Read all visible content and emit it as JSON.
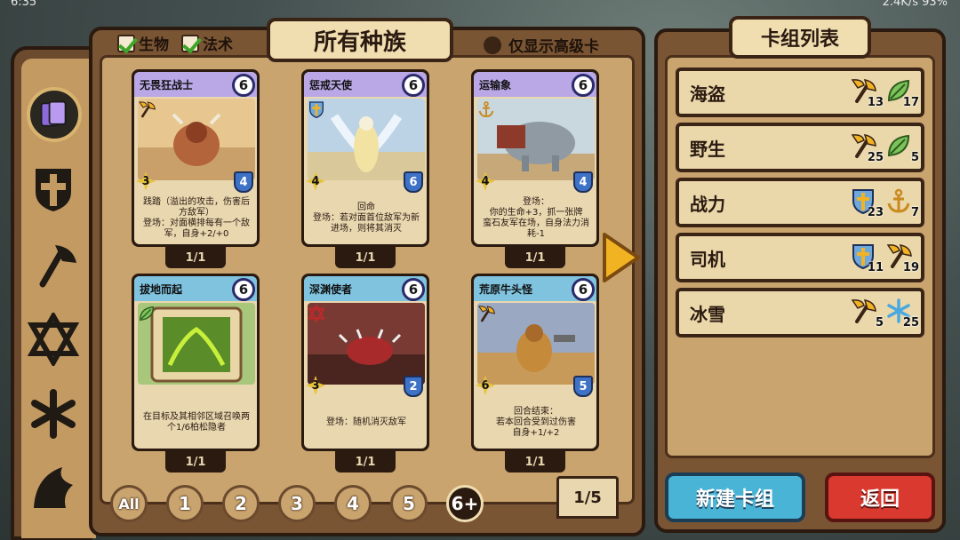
{
  "status_bar": {
    "time": "6:35",
    "right": "2.4K/s 93%"
  },
  "filters": {
    "creature_label": "生物",
    "spell_label": "法术",
    "advanced_label": "仅显示高级卡"
  },
  "tab_title": "所有种族",
  "cards": [
    {
      "name": "无畏狂战士",
      "cost": "6",
      "attack": "3",
      "health": "4",
      "text": "践踏（溢出的攻击，伤害后方敌军）\n登场：对面横排每有一个敌军，自身+2/+0",
      "count": "1/1",
      "head_color": "#b9a7e6",
      "type_icon": "axe-icon"
    },
    {
      "name": "惩戒天使",
      "cost": "6",
      "attack": "4",
      "health": "6",
      "text": "回命\n登场：若对面首位敌军为新进场，则将其消灭",
      "count": "1/1",
      "head_color": "#b9a7e6",
      "type_icon": "shield-icon"
    },
    {
      "name": "运输象",
      "cost": "6",
      "attack": "4",
      "health": "4",
      "text": "登场：\n你的生命+3，抓一张牌\n蛮石友军在场，自身法力消耗-1",
      "count": "1/1",
      "head_color": "#b9a7e6",
      "type_icon": "anchor-icon"
    },
    {
      "name": "拔地而起",
      "cost": "6",
      "attack": "",
      "health": "",
      "text": "在目标及其相邻区域召唤两个1/6柏松隐者",
      "count": "1/1",
      "head_color": "#7fc3df",
      "type_icon": "leaf-icon"
    },
    {
      "name": "深渊使者",
      "cost": "6",
      "attack": "3",
      "health": "2",
      "text": "登场：随机消灭敌军",
      "count": "1/1",
      "head_color": "#7fc3df",
      "type_icon": "star-icon"
    },
    {
      "name": "荒原牛头怪",
      "cost": "6",
      "attack": "6",
      "health": "5",
      "text": "回合结束：\n若本回合受到过伤害\n自身+1/+2",
      "count": "1/1",
      "head_color": "#7fc3df",
      "type_icon": "axe-icon"
    }
  ],
  "page_buttons": [
    "All",
    "1",
    "2",
    "3",
    "4",
    "5",
    "6+"
  ],
  "active_page_button": "6+",
  "page_indicator": "1/5",
  "deck_title": "卡组列表",
  "decks": [
    {
      "name": "海盗",
      "stats": [
        {
          "icon": "axe-icon",
          "value": "13"
        },
        {
          "icon": "leaf-icon",
          "value": "17"
        }
      ]
    },
    {
      "name": "野生",
      "stats": [
        {
          "icon": "axe-icon",
          "value": "25"
        },
        {
          "icon": "leaf-icon",
          "value": "5"
        }
      ]
    },
    {
      "name": "战力",
      "stats": [
        {
          "icon": "shield-icon",
          "value": "23"
        },
        {
          "icon": "anchor-icon",
          "value": "7"
        }
      ]
    },
    {
      "name": "司机",
      "stats": [
        {
          "icon": "shield-icon",
          "value": "11"
        },
        {
          "icon": "axe-icon",
          "value": "19"
        }
      ]
    },
    {
      "name": "冰雪",
      "stats": [
        {
          "icon": "axe-icon",
          "value": "5"
        },
        {
          "icon": "snowflake-icon",
          "value": "25"
        }
      ]
    }
  ],
  "buttons": {
    "new_deck": "新建卡组",
    "back": "返回"
  }
}
